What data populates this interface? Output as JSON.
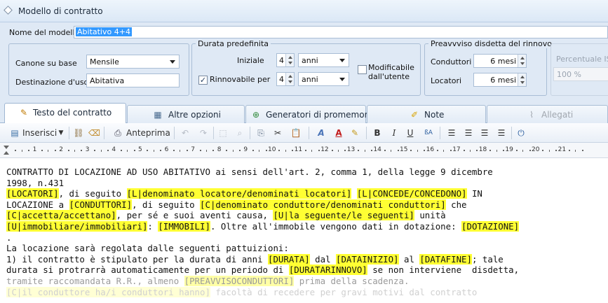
{
  "window": {
    "title": "Modello di contratto"
  },
  "header": {
    "model_name_label": "Nome del modello",
    "model_name_value": "Abitativo 4+4",
    "canone_label": "Canone su base",
    "canone_value": "Mensile",
    "destinazione_label": "Destinazione d'uso",
    "destinazione_value": "Abitativa"
  },
  "durata": {
    "group_title": "Durata predefinita",
    "iniziale_label": "Iniziale",
    "iniziale_value": "4",
    "iniziale_unit": "anni",
    "rinnovabile_label": "Rinnovabile per",
    "rinnovabile_checked": true,
    "rinnovabile_value": "4",
    "rinnovabile_unit": "anni",
    "modificabile_label_1": "Modificabile",
    "modificabile_label_2": "dall'utente",
    "modificabile_checked": false
  },
  "preavviso": {
    "group_title": "Preavvviso disdetta del rinnovo",
    "conduttori_label": "Conduttori",
    "conduttori_value": "6 mesi",
    "locatori_label": "Locatori",
    "locatori_value": "6 mesi"
  },
  "percentuale": {
    "label": "Percentuale IS",
    "value": "100 %"
  },
  "tabs": [
    {
      "label": "Testo del contratto",
      "icon": "edit-icon",
      "active": true
    },
    {
      "label": "Altre opzioni",
      "icon": "options-icon"
    },
    {
      "label": "Generatori di promemoria",
      "icon": "reminder-icon"
    },
    {
      "label": "Note",
      "icon": "note-icon"
    },
    {
      "label": "Allegati",
      "icon": "paperclip-icon",
      "disabled": true
    }
  ],
  "toolbar": {
    "insert_label": "Inserisci",
    "preview_label": "Anteprima"
  },
  "ruler": {
    "numbers": [
      "1",
      "2",
      "3",
      "4",
      "5",
      "6",
      "7",
      "8",
      "9",
      "10",
      "11",
      "12",
      "13",
      "14",
      "15",
      "16",
      "17",
      "18",
      "19",
      "20",
      "21"
    ]
  },
  "document": {
    "line1": "CONTRATTO DI LOCAZIONE AD USO ABITATIVO ai sensi dell'art. 2, comma 1, della legge 9 dicembre",
    "line2": "1998, n.431",
    "f_locatori": "[LOCATORI]",
    "t_seguito1": ", di seguito ",
    "f_denom_locatori": "[L|denominato locatore/denominati locatori]",
    "f_concede": "[L|CONCEDE/CONCEDONO]",
    "t_in": " IN",
    "t_locazione_a": "LOCAZIONE a ",
    "f_conduttori": "[CONDUTTORI]",
    "t_seguito2": ", di seguito ",
    "f_denom_conduttori": "[C|denominato conduttore/denominati conduttori]",
    "t_che": " che",
    "f_accetta": "[C|accetta/accettano]",
    "t_per_se": ", per sé e suoi aventi causa, ",
    "f_seguente": "[U|la seguente/le seguenti]",
    "t_unita": " unità",
    "f_immobiliare": "[U|immobiliare/immobiliari]",
    "t_colon": ": ",
    "f_immobili": "[IMMOBILI]",
    "t_oltre": ". Oltre all'immobile vengono dati in dotazione: ",
    "f_dotazione": "[DOTAZIONE]",
    "line_dot": ".",
    "line_regolata": "La locazione sarà regolata dalle seguenti pattuizioni:",
    "t_item1": "1) il contratto è stipulato per la durata di anni ",
    "f_durata": "[DURATA]",
    "t_dal": " dal ",
    "f_datainizio": "[DATAINIZIO]",
    "t_al": " al ",
    "f_datafine": "[DATAFINE]",
    "t_tale": "; tale",
    "t_durata_si": "durata si protrarrà automaticamente per un periodo di ",
    "f_duratarinnovo": "[DURATARINNOVO]",
    "t_se_non": " se non interviene  disdetta,",
    "t_tramite": "tramite raccomandata R.R., almeno ",
    "f_preavviso": "[PREAVVISOCONDUTTORI]",
    "t_prima": " prima della scadenza.",
    "f_ilconduttore": "[C|il conduttore ha/i conduttori hanno]",
    "t_facolta": " facoltà di recedere per gravi motivi dal contratto"
  }
}
